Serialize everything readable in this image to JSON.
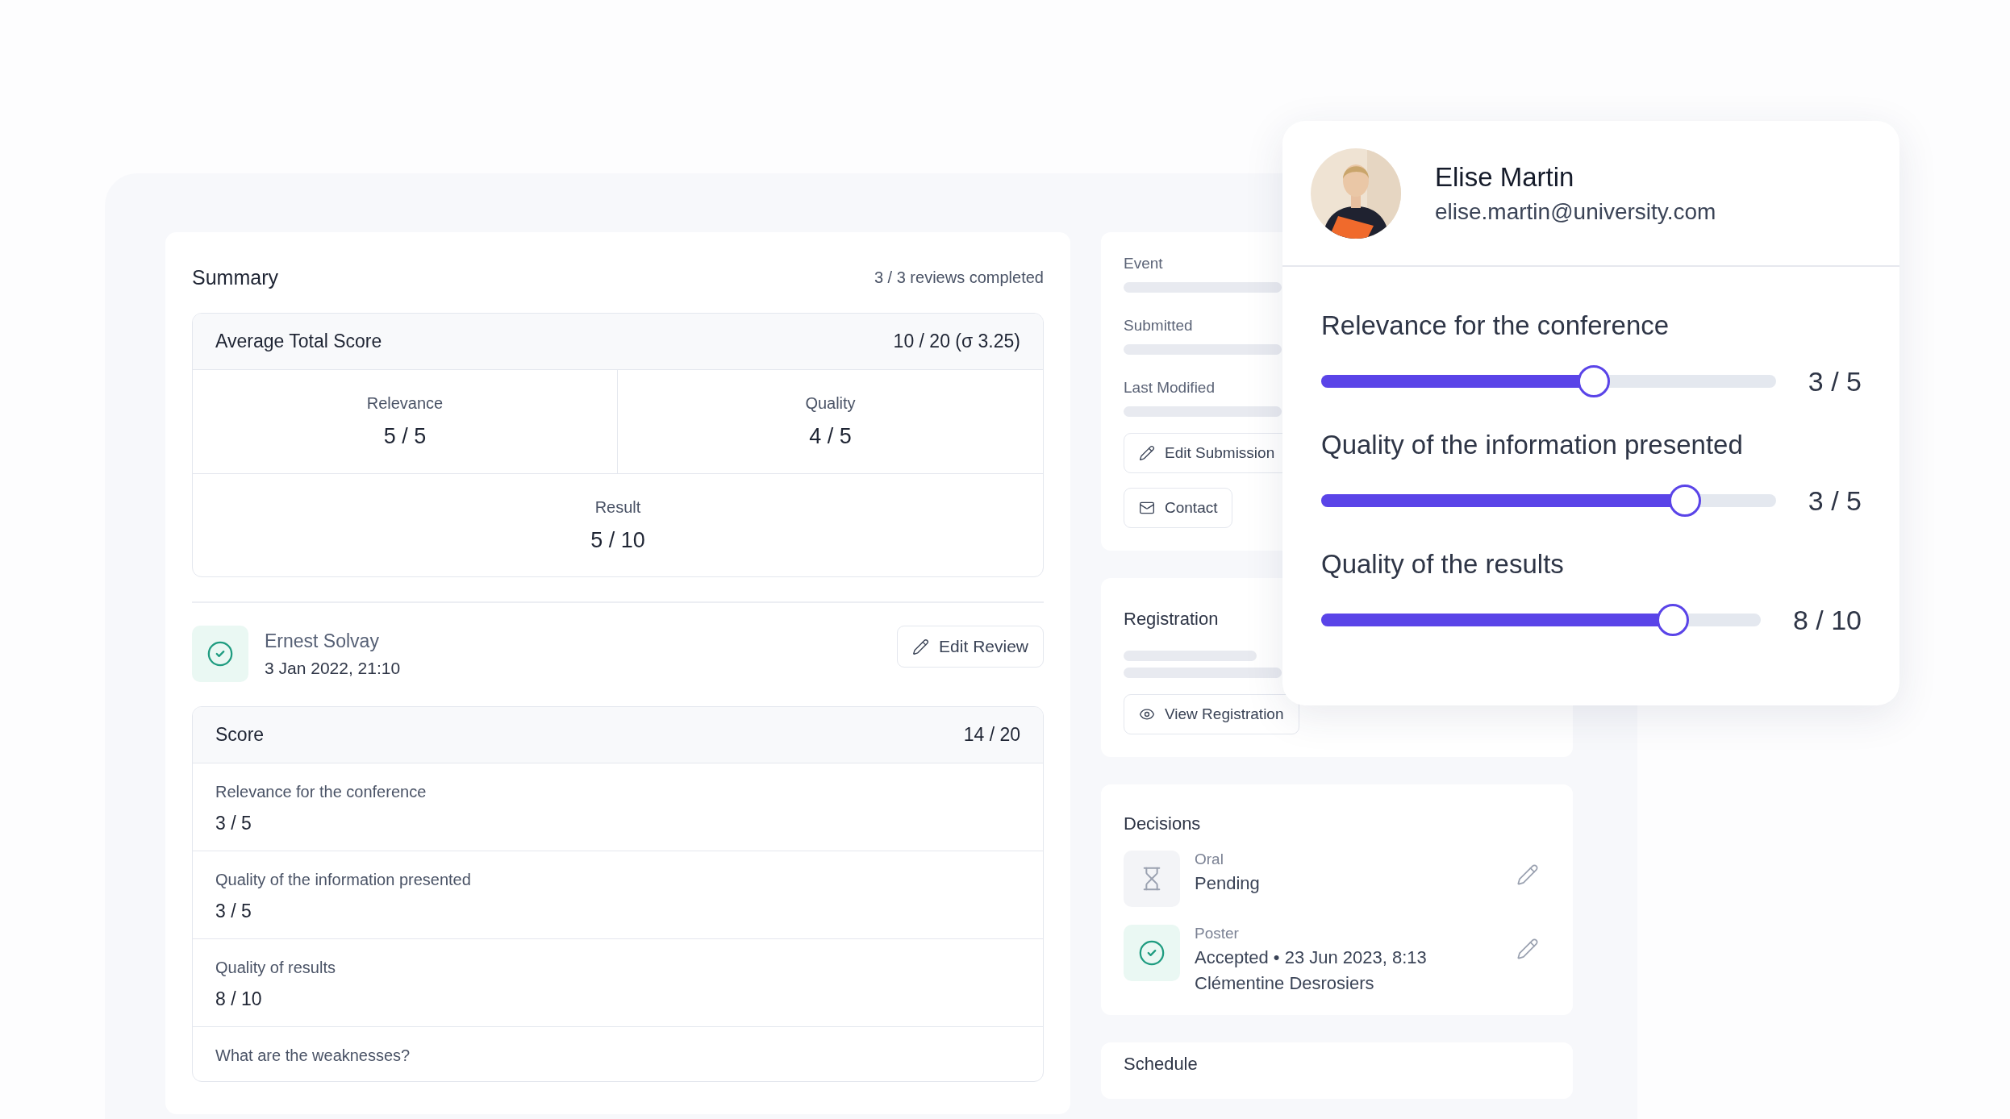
{
  "summary": {
    "title": "Summary",
    "status": "3 / 3 reviews completed",
    "average": {
      "label": "Average Total Score",
      "value": "10 / 20 (σ 3.25)"
    },
    "metrics": [
      {
        "label": "Relevance",
        "value": "5 / 5"
      },
      {
        "label": "Quality",
        "value": "4 / 5"
      },
      {
        "label": "Result",
        "value": "5 / 10"
      }
    ]
  },
  "review": {
    "reviewer": "Ernest Solvay",
    "date": "3 Jan 2022, 21:10",
    "edit_button": "Edit Review",
    "score": {
      "label": "Score",
      "value": "14 / 20"
    },
    "criteria": [
      {
        "label": "Relevance for the conference",
        "value": "3 / 5"
      },
      {
        "label": "Quality of the information presented",
        "value": "3 / 5"
      },
      {
        "label": "Quality of results",
        "value": "8 / 10"
      }
    ],
    "question": "What are the weaknesses?"
  },
  "submission": {
    "fields": [
      {
        "label": "Event"
      },
      {
        "label": "Submitted"
      },
      {
        "label": "Last Modified"
      }
    ],
    "buttons": [
      {
        "kind": "edit",
        "label": "Edit Submission"
      },
      {
        "kind": "contact",
        "label": "Contact"
      }
    ]
  },
  "registration": {
    "title": "Registration",
    "button": {
      "kind": "view",
      "label": "View Registration"
    }
  },
  "decisions": {
    "title": "Decisions",
    "items": [
      {
        "kind": "pending",
        "type": "Oral",
        "status": "Pending"
      },
      {
        "kind": "accepted",
        "type": "Poster",
        "status": "Accepted • 23 Jun 2023, 8:13",
        "by": "Clémentine Desrosiers"
      }
    ]
  },
  "schedule": {
    "title": "Schedule"
  },
  "reviewer_card": {
    "name": "Elise Martin",
    "email": "elise.martin@university.com",
    "ratings": [
      {
        "label": "Relevance for the conference",
        "level": 0.6,
        "value": "3 / 5"
      },
      {
        "label": "Quality of the information presented",
        "level": 0.8,
        "value": "3 / 5"
      },
      {
        "label": "Quality of the results",
        "level": 0.8,
        "value": "8 / 10"
      }
    ]
  }
}
